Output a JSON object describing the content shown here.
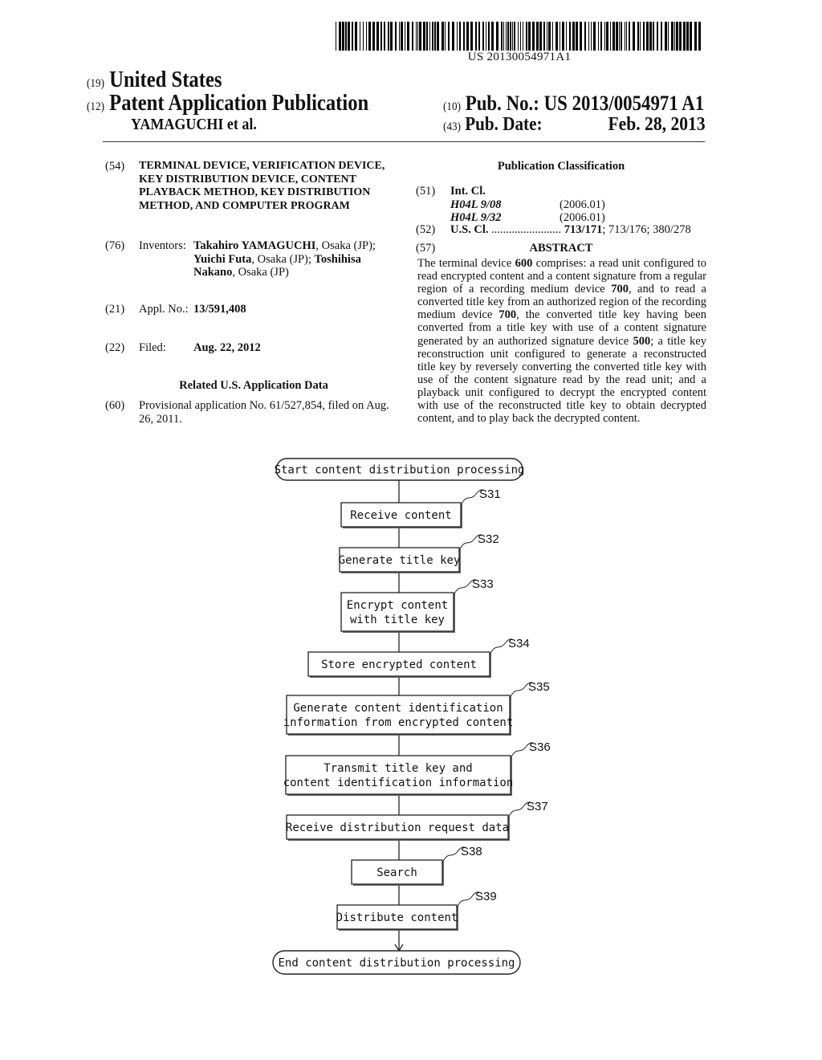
{
  "header": {
    "barcode_number": "US 20130054971A1",
    "country_code": "(19)",
    "country": "United States",
    "pubtype_code": "(12)",
    "pub_type": "Patent Application Publication",
    "inventor_short": "YAMAGUCHI et al.",
    "pub_no_code": "(10)",
    "pub_no_label": "Pub. No.:",
    "pub_no": "US 2013/0054971 A1",
    "pub_date_code": "(43)",
    "pub_date_label": "Pub. Date:",
    "pub_date": "Feb. 28, 2013"
  },
  "left": {
    "title_code": "(54)",
    "title": "TERMINAL DEVICE, VERIFICATION DEVICE, KEY DISTRIBUTION DEVICE, CONTENT PLAYBACK METHOD, KEY DISTRIBUTION METHOD, AND COMPUTER PROGRAM",
    "inventors_code": "(76)",
    "inventors_label": "Inventors:",
    "inventors": [
      {
        "name": "Takahiro YAMAGUCHI",
        "loc": ", Osaka (JP);"
      },
      {
        "name": "Yuichi Futa",
        "loc": ", Osaka (JP);"
      },
      {
        "name": "Toshihisa Nakano",
        "loc": ", Osaka (JP)"
      }
    ],
    "appl_code": "(21)",
    "appl_label": "Appl. No.:",
    "appl_no": "13/591,408",
    "filed_code": "(22)",
    "filed_label": "Filed:",
    "filed_date": "Aug. 22, 2012",
    "related_heading": "Related U.S. Application Data",
    "provisional_code": "(60)",
    "provisional_text": "Provisional application No. 61/527,854, filed on Aug. 26, 2011."
  },
  "right": {
    "classification_heading": "Publication Classification",
    "intcl_code": "(51)",
    "intcl_label": "Int. Cl.",
    "intcl": [
      {
        "class": "H04L 9/08",
        "version": "(2006.01)"
      },
      {
        "class": "H04L 9/32",
        "version": "(2006.01)"
      }
    ],
    "uscl_code": "(52)",
    "uscl_label": "U.S. Cl.",
    "uscl_dots": " ........................ ",
    "uscl_primary": "713/171",
    "uscl_rest": "; 713/176; 380/278",
    "abstract_code": "(57)",
    "abstract_heading": "ABSTRACT",
    "abstract_parts": [
      {
        "t": "The terminal device ",
        "b": false
      },
      {
        "t": "600",
        "b": true
      },
      {
        "t": " comprises: a read unit configured to read encrypted content and a content signature from a regular region of a recording medium device ",
        "b": false
      },
      {
        "t": "700",
        "b": true
      },
      {
        "t": ", and to read a converted title key from an authorized region of the recording medium device ",
        "b": false
      },
      {
        "t": "700",
        "b": true
      },
      {
        "t": ", the converted title key having been converted from a title key with use of a content signature generated by an authorized signature device ",
        "b": false
      },
      {
        "t": "500",
        "b": true
      },
      {
        "t": "; a title key reconstruction unit configured to generate a reconstructed title key by reversely converting the converted title key with use of the content signature read by the read unit; and a playback unit configured to decrypt the encrypted content with use of the reconstructed title key to obtain decrypted content, and to play back the decrypted content.",
        "b": false
      }
    ]
  },
  "flowchart": {
    "start": "Start content distribution processing",
    "end": "End content distribution processing",
    "steps": [
      {
        "id": "S31",
        "lines": [
          "Receive content"
        ]
      },
      {
        "id": "S32",
        "lines": [
          "Generate title key"
        ]
      },
      {
        "id": "S33",
        "lines": [
          "Encrypt content",
          "with title key"
        ]
      },
      {
        "id": "S34",
        "lines": [
          "Store encrypted content"
        ]
      },
      {
        "id": "S35",
        "lines": [
          "Generate content identification",
          "information from encrypted content"
        ]
      },
      {
        "id": "S36",
        "lines": [
          "Transmit title key and",
          "content identification information"
        ]
      },
      {
        "id": "S37",
        "lines": [
          "Receive distribution request data"
        ]
      },
      {
        "id": "S38",
        "lines": [
          "Search"
        ]
      },
      {
        "id": "S39",
        "lines": [
          "Distribute content"
        ]
      }
    ]
  }
}
